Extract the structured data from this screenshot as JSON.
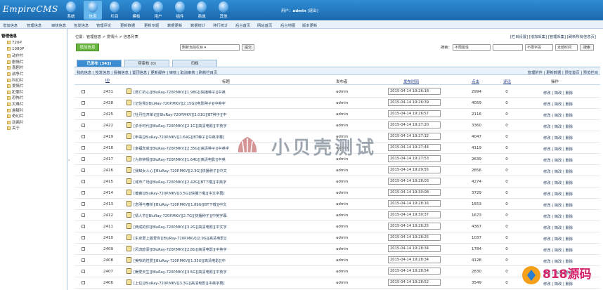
{
  "app": {
    "logo_main": "EmpireCMS",
    "logo_sub": "帝国"
  },
  "topnav": [
    {
      "label": "系统",
      "icon": "system-icon",
      "active": false
    },
    {
      "label": "信息",
      "icon": "info-icon",
      "active": true
    },
    {
      "label": "栏目",
      "icon": "column-icon",
      "active": false
    },
    {
      "label": "模板",
      "icon": "template-icon",
      "active": false
    },
    {
      "label": "用户",
      "icon": "user-icon",
      "active": false
    },
    {
      "label": "插件",
      "icon": "plugin-icon",
      "active": false
    },
    {
      "label": "商城",
      "icon": "shop-icon",
      "active": false
    },
    {
      "label": "其他",
      "icon": "other-icon",
      "active": false
    }
  ],
  "user": {
    "prefix": "用户：",
    "name": "admin",
    "logout": "[退出]"
  },
  "menubar": [
    "增加信息",
    "管理信息",
    "审核信息",
    "签发信息",
    "管理评论",
    "更新数据",
    "更新专题",
    "数据更新",
    "数据统计",
    "排行统计",
    "后台首页",
    "网站首页",
    "后台地图",
    "版本更新"
  ],
  "sidebar": {
    "head": "管理信息",
    "items": [
      "720P",
      "1080P",
      "动作片",
      "剧情片",
      "喜剧片",
      "战争片",
      "科幻片",
      "爱情片",
      "犯罪片",
      "恐怖片",
      "灾难片",
      "悬疑片",
      "奇幻片",
      "动画片",
      "关于"
    ]
  },
  "breadcrumb": "位置：管理信息 > 爱情片 > 信息列表",
  "toplinks": "[栏目设置] [增加采集] [管理采集] [刷新所有信息页]",
  "add_button": "增加信息",
  "column_select": "刷新当前栏目 ▾",
  "column_select_submit": "提交",
  "search": {
    "label": "搜索：",
    "field": "不限属性",
    "keyword": "",
    "scope": "不限字段",
    "time": "全部时间",
    "submit": "搜索"
  },
  "tabs": [
    {
      "label": "已发布 (343)",
      "active": true
    },
    {
      "label": "待审核 (0)",
      "active": false
    },
    {
      "label": "归档",
      "active": false
    }
  ],
  "subbar_left": "我的信息 | 签发信息 | 投稿信息 | 置顶信息 | 更新缓存 | 审核 | 取消审核 | 刷新栏目页",
  "subbar_right": "管理附件 | 更新数据 | 预览首页 | 预览栏目",
  "columns": {
    "id": "ID",
    "title": "标题",
    "publisher": "发布者",
    "time": "发布时间",
    "clicks": "点击",
    "comments": "评论",
    "ops": "操作"
  },
  "rows": [
    {
      "id": "2431",
      "title": "[救亡的心][BluRay-720P.MKV][1.98G][快播种子][中英",
      "publisher": "admin",
      "time": "2015-04-14 19:26:18",
      "clicks": "2994",
      "comments": "0",
      "ops": "修改 | 简改 | 删除"
    },
    {
      "id": "2428",
      "title": "[记住我][BluRay-720P.MKV][2.15G][电影种子][中英字",
      "publisher": "admin",
      "time": "2015-04-14 19:26:39",
      "clicks": "4059",
      "comments": "0",
      "ops": "修改 | 简改 | 删除"
    },
    {
      "id": "2425",
      "title": "[牡丹拉开单记][BluRay-720P.MKV][2.01G][BT种子][中",
      "publisher": "admin",
      "time": "2015-04-14 19:26:57",
      "clicks": "2116",
      "comments": "0",
      "ops": "修改 | 简改 | 删除"
    },
    {
      "id": "2422",
      "title": "[杀手时代][BluRay-720P.MKV][2.1G][高清电影][中英字",
      "publisher": "admin",
      "time": "2015-04-14 19:27:20",
      "clicks": "3360",
      "comments": "0",
      "ops": "修改 | 简改 | 删除"
    },
    {
      "id": "2419",
      "title": "[申毒][BluRay-720P.MKV][1.64G][BT种子][中英字幕]",
      "publisher": "admin",
      "time": "2015-04-14 19:27:32",
      "clicks": "4047",
      "comments": "0",
      "ops": "修改 | 简改 | 删除"
    },
    {
      "id": "2418",
      "title": "[幸福您就][BluRay-720P.MKV][2.35G][高清种子][中英字",
      "publisher": "admin",
      "time": "2015-04-14 19:27:44",
      "clicks": "4119",
      "comments": "0",
      "ops": "修改 | 简改 | 删除"
    },
    {
      "id": "2417",
      "title": "[为你钟情][BluRay-720P.MKV][1.64G][高清电影][中英",
      "publisher": "admin",
      "time": "2015-04-14 19:27:53",
      "clicks": "2639",
      "comments": "0",
      "ops": "修改 | 简改 | 删除"
    },
    {
      "id": "2416",
      "title": "[我知女人心][BluRay-720P.MKV][2.3G][快播种子][中文",
      "publisher": "admin",
      "time": "2015-04-14 19:29:55",
      "clicks": "2856",
      "comments": "0",
      "ops": "修改 | 简改 | 删除"
    },
    {
      "id": "2415",
      "title": "[城市广场][BluRay-720P.MKV][2.42G][BT下载][中英字",
      "publisher": "admin",
      "time": "2015-04-14 19:28:03",
      "clicks": "4274",
      "comments": "0",
      "ops": "修改 | 简改 | 删除"
    },
    {
      "id": "2414",
      "title": "[偏奋][BluRay-720P.MKV][3.5G][快播下载][中文字幕]",
      "publisher": "admin",
      "time": "2015-04-14 19:30:08",
      "clicks": "3729",
      "comments": "0",
      "ops": "修改 | 简改 | 删除"
    },
    {
      "id": "2413",
      "title": "[念明与春桥][BluRay-720P.MKV][1.89G][BT下载][中文",
      "publisher": "admin",
      "time": "2015-04-14 19:28:16",
      "clicks": "1553",
      "comments": "0",
      "ops": "修改 | 简改 | 删除"
    },
    {
      "id": "2412",
      "title": "[情人节][BluRay-720P.MKV][2.7G][快播种子][中英字幕",
      "publisher": "admin",
      "time": "2015-04-14 19:30:37",
      "clicks": "1673",
      "comments": "0",
      "ops": "修改 | 简改 | 删除"
    },
    {
      "id": "2411",
      "title": "[两成的你][BluRay-720P.MKV][3.2G][高清电影][中文字",
      "publisher": "admin",
      "time": "2015-04-14 19:28:25",
      "clicks": "4367",
      "comments": "0",
      "ops": "修改 | 简改 | 删除"
    },
    {
      "id": "2410",
      "title": "[东京爱上最爱你][BluRay-720P.MKV][2.9G][高清电影][",
      "publisher": "admin",
      "time": "2015-04-14 19:28:25",
      "clicks": "1037",
      "comments": "0",
      "ops": "修改 | 简改 | 删除"
    },
    {
      "id": "2409",
      "title": "[风流欧豪][BluRay-720P.MKV][2.8G][高清电影][中英字",
      "publisher": "admin",
      "time": "2015-04-14 19:28:34",
      "clicks": "1784",
      "comments": "0",
      "ops": "修改 | 简改 | 删除"
    },
    {
      "id": "2408",
      "title": "[美味的性爱][BluRay-720P.MKV][1.35G][高清电影][中",
      "publisher": "admin",
      "time": "2015-04-14 19:28:34",
      "clicks": "4128",
      "comments": "0",
      "ops": "修改 | 简改 | 删除"
    },
    {
      "id": "2407",
      "title": "[暖爱天生][BluRay-720P.MKV][3.5G][高清电影][中英字",
      "publisher": "admin",
      "time": "2015-04-14 19:28:54",
      "clicks": "2830",
      "comments": "0",
      "ops": "修改 | 简改 | 删除"
    },
    {
      "id": "2406",
      "title": "[上位][BluRay-720P.MKV][3.3G][高清电影][中英字幕]",
      "publisher": "admin",
      "time": "2015-04-14 19:28:52",
      "clicks": "3549",
      "comments": "0",
      "ops": "修改 | 简改 | 删除"
    }
  ],
  "watermark": "小贝壳测试",
  "brand": {
    "main": "818源码",
    "url": "www.818ym.com"
  },
  "colors": {
    "topbar": "#1f73b8",
    "add_button": "#67b53c",
    "active_tab": "#3b8cd1"
  }
}
